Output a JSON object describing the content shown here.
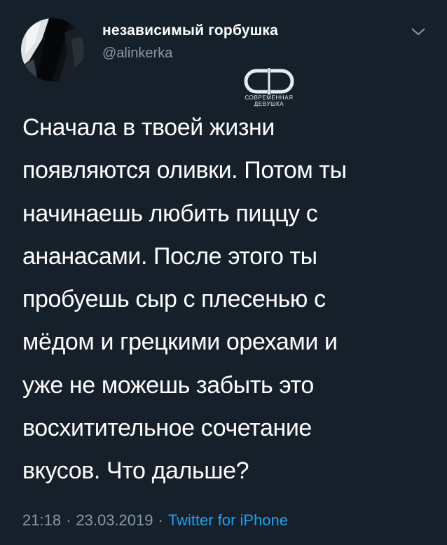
{
  "user": {
    "display_name": "независимый горбушка",
    "handle": "@alinkerka"
  },
  "icons": {
    "avatar": "profile-photo",
    "menu": "chevron-down-icon",
    "watermark": "sovremennaya-devushka-logo"
  },
  "watermark": {
    "line1": "СОВРЕМЕННАЯ",
    "line2": "ДЕВУШКА"
  },
  "tweet": {
    "lines": [
      "Сначала в твоей жизни",
      "появляются оливки. Потом ты",
      "начинаешь любить пиццу с",
      "ананасами. После этого ты",
      "пробуешь сыр с плесенью с",
      "мёдом и грецкими орехами и",
      "уже не можешь забыть это",
      "восхитительное сочетание",
      "вкусов. Что дальше?"
    ]
  },
  "meta": {
    "time": "21:18",
    "separator": "·",
    "date": "23.03.2019",
    "source": "Twitter for iPhone"
  },
  "colors": {
    "background": "#15202b",
    "text": "#ffffff",
    "secondary": "#8899a6",
    "link": "#1da1f2"
  }
}
